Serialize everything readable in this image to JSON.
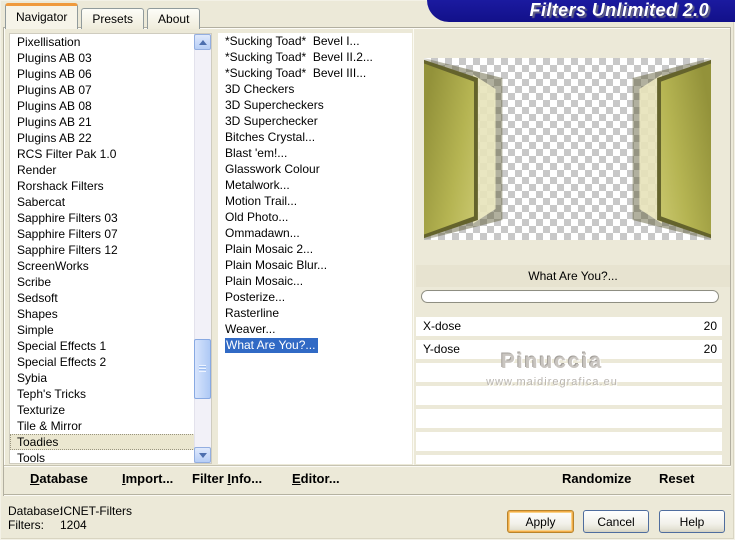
{
  "banner": {
    "title": "Filters Unlimited 2.0"
  },
  "tabs": [
    {
      "label": "Navigator"
    },
    {
      "label": "Presets"
    },
    {
      "label": "About"
    }
  ],
  "category_list": {
    "selected": "Toadies",
    "items": [
      "Pixellisation",
      "Plugins AB 03",
      "Plugins AB 06",
      "Plugins AB 07",
      "Plugins AB 08",
      "Plugins AB 21",
      "Plugins AB 22",
      "RCS Filter Pak 1.0",
      "Render",
      "Rorshack Filters",
      "Sabercat",
      "Sapphire Filters 03",
      "Sapphire Filters 07",
      "Sapphire Filters 12",
      "ScreenWorks",
      "Scribe",
      "Sedsoft",
      "Shapes",
      "Simple",
      "Special Effects 1",
      "Special Effects 2",
      "Sybia",
      "Teph's Tricks",
      "Texturize",
      "Tile & Mirror",
      "Toadies",
      "Tools"
    ]
  },
  "filter_list": {
    "selected": "What Are You?...",
    "items": [
      "*Sucking Toad*  Bevel I...",
      "*Sucking Toad*  Bevel II.2...",
      "*Sucking Toad*  Bevel III...",
      "3D Checkers",
      "3D Supercheckers",
      "3D Superchecker",
      "Bitches Crystal...",
      "Blast 'em!...",
      "Glasswork Colour",
      "Metalwork...",
      "Motion Trail...",
      "Old Photo...",
      "Ommadawn...",
      "Plain Mosaic 2...",
      "Plain Mosaic Blur...",
      "Plain Mosaic...",
      "Posterize...",
      "Rasterline",
      "Weaver...",
      "What Are You?..."
    ]
  },
  "preview": {
    "filter_name": "What Are You?...",
    "progress_percent": 0,
    "watermark_name": "Pinuccia",
    "watermark_site": "www.maidiregrafica.eu"
  },
  "parameters": [
    {
      "label": "X-dose",
      "value": "20"
    },
    {
      "label": "Y-dose",
      "value": "20"
    }
  ],
  "band": {
    "database": {
      "pre": "",
      "key": "D",
      "post": "atabase"
    },
    "import": {
      "pre": "",
      "key": "I",
      "post": "mport..."
    },
    "filter_info": {
      "pre": "Filter ",
      "key": "I",
      "post": "nfo..."
    },
    "editor": {
      "pre": "",
      "key": "E",
      "post": "ditor..."
    },
    "randomize": "Randomize",
    "reset": "Reset"
  },
  "status": {
    "database_label": "Database:",
    "database_value": "ICNET-Filters",
    "filters_label": "Filters:",
    "filters_value": "1204"
  },
  "buttons": {
    "apply": "Apply",
    "cancel": "Cancel",
    "help": "Help"
  },
  "colors": {
    "banner_navy": "#12108a",
    "selection_blue": "#316ac5",
    "preview_olive": "#b5b452",
    "dialog_beige": "#ece9d8",
    "checker_gray": "#c8c8c8"
  }
}
